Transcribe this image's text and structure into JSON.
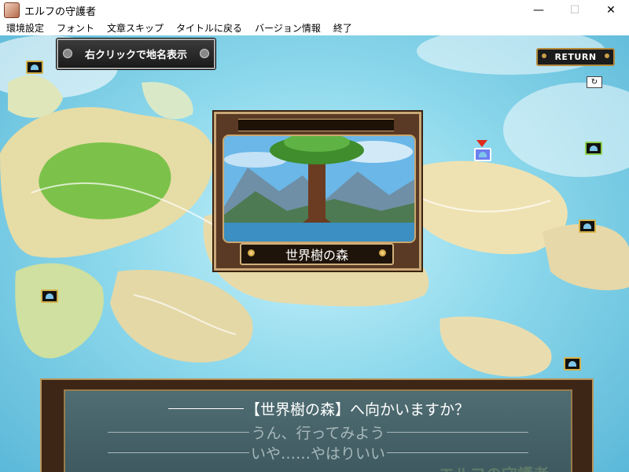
{
  "window": {
    "title": "エルフの守護者",
    "controls": {
      "minimize": "—",
      "maximize": "☐",
      "close": "✕"
    }
  },
  "menu": {
    "items": [
      "環境設定",
      "フォント",
      "文章スキップ",
      "タイトルに戻る",
      "バージョン情報",
      "終了"
    ]
  },
  "hud": {
    "hint": "右クリックで地名表示",
    "return_label": "RETURN",
    "cycle_icon": "cycle-icon"
  },
  "preview": {
    "place_name": "世界樹の森"
  },
  "dialog": {
    "question": "【世界樹の森】へ向かいますか？",
    "options": [
      "うん、行ってみよう",
      "いや……やはりいい"
    ],
    "watermark": "エルフの守護者"
  },
  "colors": {
    "sea": "#8ed9ec",
    "land": "#e9dcae",
    "forest": "#7cc24a",
    "panel_frame": "#5a3a24",
    "dialog_bg": "#4f6d73",
    "marker_border": "#d4b24a"
  }
}
